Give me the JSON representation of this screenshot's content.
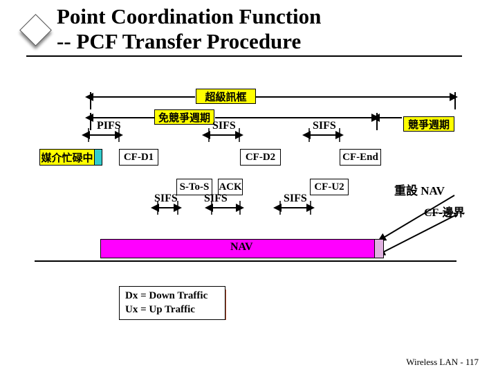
{
  "title_line1": "Point Coordination Function",
  "title_line2": "-- PCF Transfer Procedure",
  "labels": {
    "superframe": "超級訊框",
    "cf_period": "免競爭週期",
    "contention_period": "競爭週期",
    "pifs": "PIFS",
    "sifs": "SIFS",
    "busy": "媒介忙碌中",
    "reset_nav": "重設 NAV",
    "cf_boundary": "CF-邊界",
    "nav": "NAV"
  },
  "frames": {
    "cfd1": "CF-D1",
    "stos": "S-To-S",
    "ack": "ACK",
    "cfd2": "CF-D2",
    "cfu2": "CF-U2",
    "cfend": "CF-End"
  },
  "legend": {
    "line1": "Dx = Down Traffic",
    "line2": "Ux = Up Traffic"
  },
  "footer": "Wireless LAN - 117"
}
